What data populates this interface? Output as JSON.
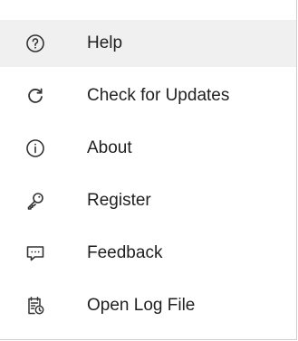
{
  "menu": {
    "items": [
      {
        "label": "Help",
        "icon": "help-circle-icon",
        "highlighted": true
      },
      {
        "label": "Check for Updates",
        "icon": "refresh-icon"
      },
      {
        "label": "About",
        "icon": "info-circle-icon"
      },
      {
        "label": "Register",
        "icon": "key-icon"
      },
      {
        "label": "Feedback",
        "icon": "chat-bubble-icon"
      },
      {
        "label": "Open Log File",
        "icon": "log-file-icon"
      }
    ]
  },
  "colors": {
    "highlight": "#f0f0f0",
    "text": "#1f1f1f",
    "icon": "#333333",
    "border": "#cfcfcf"
  }
}
